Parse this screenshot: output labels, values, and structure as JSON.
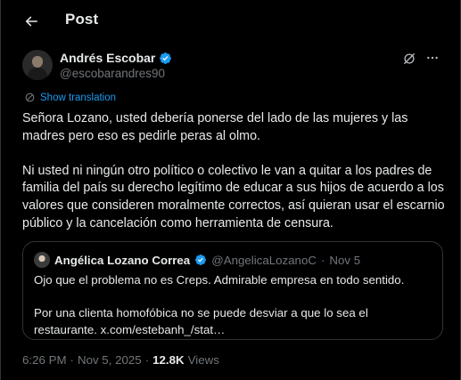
{
  "header": {
    "title": "Post"
  },
  "author": {
    "name": "Andrés Escobar",
    "handle": "@escobarandres90",
    "verified": true
  },
  "translate": {
    "label": "Show translation"
  },
  "post": {
    "paragraphs": [
      "Señora Lozano, usted debería ponerse del lado de las mujeres y las madres pero eso es pedirle peras al olmo.",
      "Ni usted ni ningún otro político o colectivo le van a quitar a los padres de familia del país su derecho legítimo de educar a sus hijos de acuerdo a los valores que consideren moralmente correctos, así quieran usar el escarnio público y la cancelación como herramienta de censura."
    ]
  },
  "quote": {
    "name": "Angélica Lozano Correa",
    "handle": "@AngelicaLozanoC",
    "separator": "·",
    "date": "Nov 5",
    "verified": true,
    "paragraphs": [
      "Ojo que el problema no es Creps. Admirable empresa en todo sentido.",
      "Por una clienta homofóbica no se puede desviar a que lo sea el restaurante. x.com/estebanh_/stat…"
    ]
  },
  "meta": {
    "time": "6:26 PM",
    "separator": "·",
    "date": "Nov 5, 2025",
    "separator2": "·",
    "views_count": "12.8K",
    "views_label": "Views"
  },
  "colors": {
    "background": "#000000",
    "text": "#e7e9ea",
    "muted": "#71767b",
    "accent": "#1d9bf0",
    "border": "#2f3336"
  },
  "icons": {
    "back": "arrow-left-icon",
    "verified": "verified-badge-icon",
    "grok": "grok-icon",
    "more": "more-horizontal-icon",
    "translate": "translate-globe-icon"
  }
}
